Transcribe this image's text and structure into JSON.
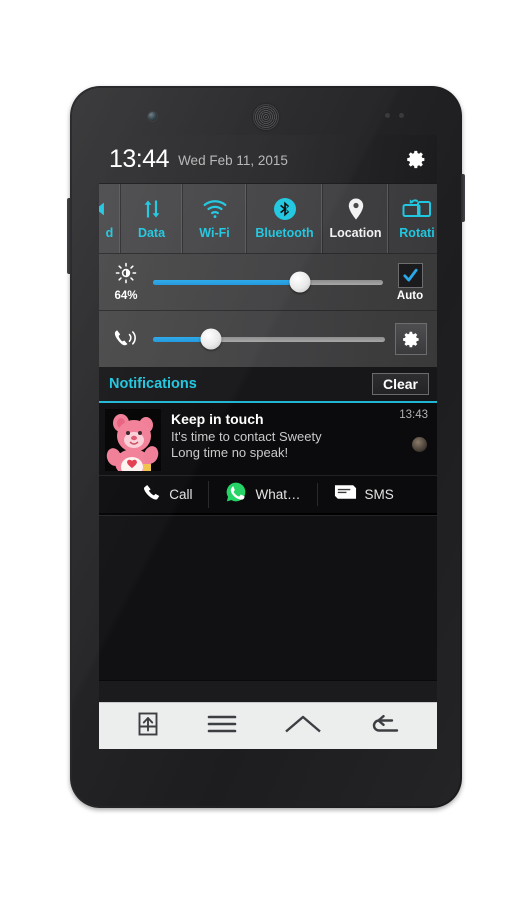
{
  "statusbar": {
    "time": "13:44",
    "date": "Wed Feb 11, 2015",
    "settings_icon": "gear-icon"
  },
  "quick_toggles": [
    {
      "label": "d",
      "icon": "sound-icon",
      "state": "on",
      "truncated": true
    },
    {
      "label": "Data",
      "icon": "data-icon",
      "state": "on",
      "truncated": false
    },
    {
      "label": "Wi-Fi",
      "icon": "wifi-icon",
      "state": "on",
      "truncated": false
    },
    {
      "label": "Bluetooth",
      "icon": "bluetooth-icon",
      "state": "on",
      "truncated": false
    },
    {
      "label": "Location",
      "icon": "location-pin-icon",
      "state": "off",
      "truncated": false
    },
    {
      "label": "Rotati",
      "icon": "rotation-icon",
      "state": "on",
      "truncated": true
    }
  ],
  "brightness": {
    "icon": "brightness-sun-icon",
    "percent_label": "64%",
    "value": 64,
    "auto_label": "Auto",
    "auto_checked": true,
    "check_icon": "checkmark-icon"
  },
  "volume": {
    "icon": "ringer-volume-icon",
    "value": 25,
    "settings_icon": "gear-icon"
  },
  "notifications_header": {
    "title": "Notifications",
    "clear_label": "Clear"
  },
  "notification": {
    "icon": "care-bear-avatar",
    "title": "Keep in touch",
    "line1": "It's time to contact Sweety",
    "line2": "Long time no speak!",
    "time": "13:43",
    "contact_avatar": "contact-photo",
    "actions": [
      {
        "label": "Call",
        "icon": "phone-icon"
      },
      {
        "label": "What…",
        "icon": "whatsapp-icon"
      },
      {
        "label": "SMS",
        "icon": "sms-message-icon"
      }
    ]
  },
  "navbar": [
    {
      "name": "share-icon"
    },
    {
      "name": "menu-icon"
    },
    {
      "name": "home-icon"
    },
    {
      "name": "back-icon"
    }
  ],
  "colors": {
    "accent_cyan": "#1fc7e0",
    "slider_blue": "#2aa8e8",
    "whatsapp_green": "#25d366",
    "inactive_white": "#f2f2f2"
  }
}
